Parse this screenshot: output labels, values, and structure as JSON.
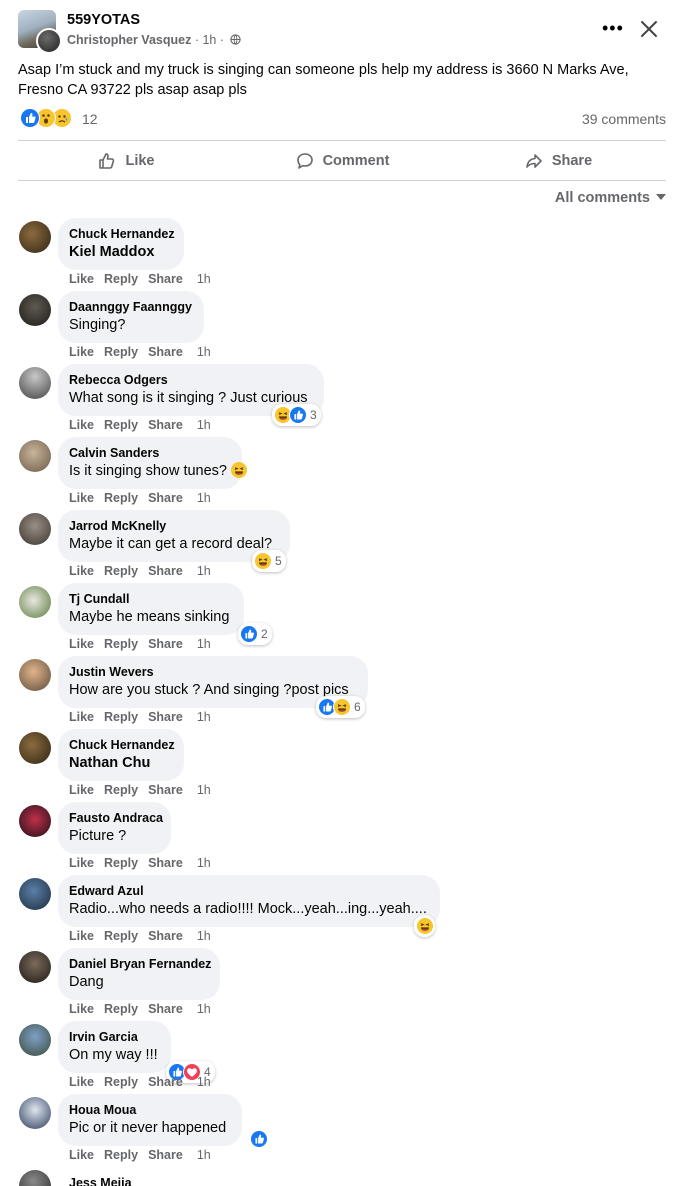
{
  "post": {
    "group_name": "559YOTAS",
    "author": "Christopher Vasquez",
    "time": "1h",
    "text": "Asap I’m stuck and my truck is singing can someone pls help my address is 3660 N Marks Ave, Fresno CA 93722 pls asap asap pls",
    "reaction_count": "12",
    "reaction_icons": [
      "like-icon",
      "wow-icon",
      "sad-icon"
    ],
    "comments_count": "39 comments"
  },
  "actions": {
    "like": "Like",
    "comment": "Comment",
    "share": "Share"
  },
  "filter": {
    "label": "All comments"
  },
  "comment_actions": {
    "like": "Like",
    "reply": "Reply",
    "share": "Share"
  },
  "comments": [
    {
      "name": "Chuck Hernandez",
      "text": "Kiel Maddox",
      "time": "1h",
      "tag": true
    },
    {
      "name": "Daannggy Faannggy",
      "text": "Singing?",
      "time": "1h"
    },
    {
      "name": "Rebecca Odgers",
      "text": "What song is it singing ? Just curious",
      "time": "1h",
      "reactions": [
        "haha",
        "like"
      ],
      "reaction_count": "3"
    },
    {
      "name": "Calvin Sanders",
      "text": "Is it singing show tunes?",
      "time": "1h",
      "inline_emoji": "laughing-face-icon"
    },
    {
      "name": "Jarrod McKnelly",
      "text": "Maybe it can get a record deal?",
      "time": "1h",
      "reactions": [
        "haha"
      ],
      "reaction_count": "5"
    },
    {
      "name": "Tj Cundall",
      "text": "Maybe he means sinking",
      "time": "1h",
      "reactions": [
        "like"
      ],
      "reaction_count": "2"
    },
    {
      "name": "Justin Wevers",
      "text": "How are you stuck ? And singing ?post pics",
      "time": "1h",
      "reactions": [
        "like",
        "haha"
      ],
      "reaction_count": "6"
    },
    {
      "name": "Chuck Hernandez",
      "text": "Nathan Chu",
      "time": "1h",
      "tag": true
    },
    {
      "name": "Fausto Andraca",
      "text": "Picture ?",
      "time": "1h"
    },
    {
      "name": "Edward Azul",
      "text": "Radio...who needs a radio!!!! Mock...yeah...ing...yeah....",
      "time": "1h",
      "reactions": [
        "haha"
      ],
      "reaction_count": ""
    },
    {
      "name": "Daniel Bryan Fernandez",
      "text": "Dang",
      "time": "1h"
    },
    {
      "name": "Irvin Garcia",
      "text": "On my way !!!",
      "time": "1h",
      "reactions": [
        "like",
        "love"
      ],
      "reaction_count": "4"
    },
    {
      "name": "Houa Moua",
      "text": "Pic or it never happened",
      "time": "1h",
      "reactions": [
        "like"
      ],
      "reaction_count": ""
    }
  ],
  "partial_comment": {
    "name": "Jess Mejia"
  },
  "colors": {
    "brand_blue": "#1877f2",
    "bubble_gray": "#f0f2f5",
    "secondary_text": "#65676b",
    "haha_yellow": "#f7c52d",
    "love_red": "#f33e58"
  }
}
